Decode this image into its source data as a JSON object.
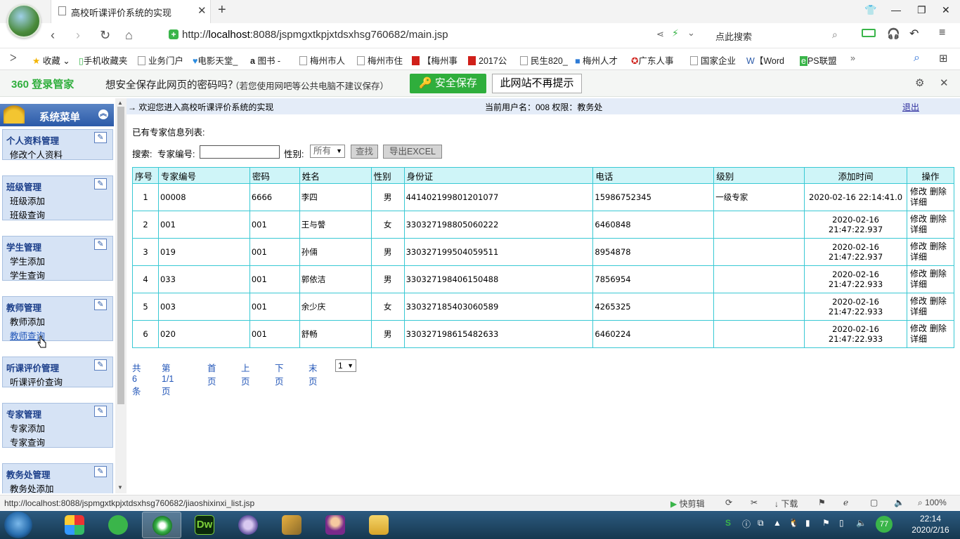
{
  "browser": {
    "tab_title": "高校听课评价系统的实现",
    "url_prefix": "http://",
    "url_host": "localhost",
    "url_rest": ":8088/jspmgxtkpjxtdsxhsg760682/main.jsp",
    "search_placeholder": "点此搜索",
    "bookmarks": [
      "收藏",
      "手机收藏夹",
      "业务门户",
      "电影天堂_",
      "图书 -",
      "梅州市人",
      "梅州市住",
      "【梅州事",
      "2017公",
      "民生820_",
      "梅州人才",
      "广东人事",
      "国家企业",
      "【Word",
      "PS联盟",
      "»"
    ],
    "password_bar": {
      "brand": "360 登录管家",
      "message": "想安全保存此网页的密码吗？",
      "hint": "（若您使用网吧等公共电脑不建议保存）",
      "save_label": "安全保存",
      "no_label": "此网站不再提示"
    },
    "status_url": "http://localhost:8088/jspmgxtkpjxtdsxhsg760682/jiaoshixinxi_list.jsp",
    "status_items": [
      "快剪辑",
      "下载",
      "100%"
    ]
  },
  "header": {
    "welcome": "→ 欢迎您进入高校听课评价系统的实现",
    "user_info": "当前用户名：008 权限：教务处",
    "logout": "退出"
  },
  "sidebar": {
    "title": "系统菜单",
    "sections": [
      {
        "title": "个人资料管理",
        "items": [
          "修改个人资料"
        ]
      },
      {
        "title": "班级管理",
        "items": [
          "班级添加",
          "班级查询"
        ]
      },
      {
        "title": "学生管理",
        "items": [
          "学生添加",
          "学生查询"
        ]
      },
      {
        "title": "教师管理",
        "items": [
          "教师添加",
          "教师查询"
        ]
      },
      {
        "title": "听课评价管理",
        "items": [
          "听课评价查询"
        ]
      },
      {
        "title": "专家管理",
        "items": [
          "专家添加",
          "专家查询"
        ]
      },
      {
        "title": "教务处管理",
        "items": [
          "教务处添加"
        ]
      }
    ]
  },
  "main": {
    "list_title": "已有专家信息列表:",
    "search_label": "搜索:",
    "code_label": "专家编号:",
    "code_value": "",
    "sex_label": "性别:",
    "sex_selected": "所有",
    "find_button": "查找",
    "export_button": "导出EXCEL",
    "columns": [
      "序号",
      "专家编号",
      "密码",
      "姓名",
      "性别",
      "身份证",
      "电话",
      "级别",
      "添加时间",
      "操作"
    ],
    "rows": [
      [
        "1",
        "00008",
        "6666",
        "李四",
        "男",
        "441402199801201077",
        "15986752345",
        "一级专家",
        "2020-02-16 22:14:41.0"
      ],
      [
        "2",
        "001",
        "001",
        "王与謦",
        "女",
        "330327198805060222",
        "6460848",
        "",
        "2020-02-16 21:47:22.937"
      ],
      [
        "3",
        "019",
        "001",
        "孙倆",
        "男",
        "330327199504059511",
        "8954878",
        "",
        "2020-02-16 21:47:22.937"
      ],
      [
        "4",
        "033",
        "001",
        "郭依洁",
        "男",
        "330327198406150488",
        "7856954",
        "",
        "2020-02-16 21:47:22.933"
      ],
      [
        "5",
        "003",
        "001",
        "余少庆",
        "女",
        "330327185403060589",
        "4265325",
        "",
        "2020-02-16 21:47:22.933"
      ],
      [
        "6",
        "020",
        "001",
        "舒畅",
        "男",
        "330327198615482633",
        "6460224",
        "",
        "2020-02-16 21:47:22.933"
      ]
    ],
    "op_edit": "修改",
    "op_delete": "删除",
    "op_detail": "详细",
    "pager": {
      "total": "共6条",
      "page": "第1/1页",
      "first": "首页",
      "prev": "上页",
      "next": "下页",
      "last": "末页",
      "page_select": "1"
    }
  },
  "taskbar": {
    "time": "22:14",
    "date": "2020/2/16",
    "badge": "77"
  }
}
